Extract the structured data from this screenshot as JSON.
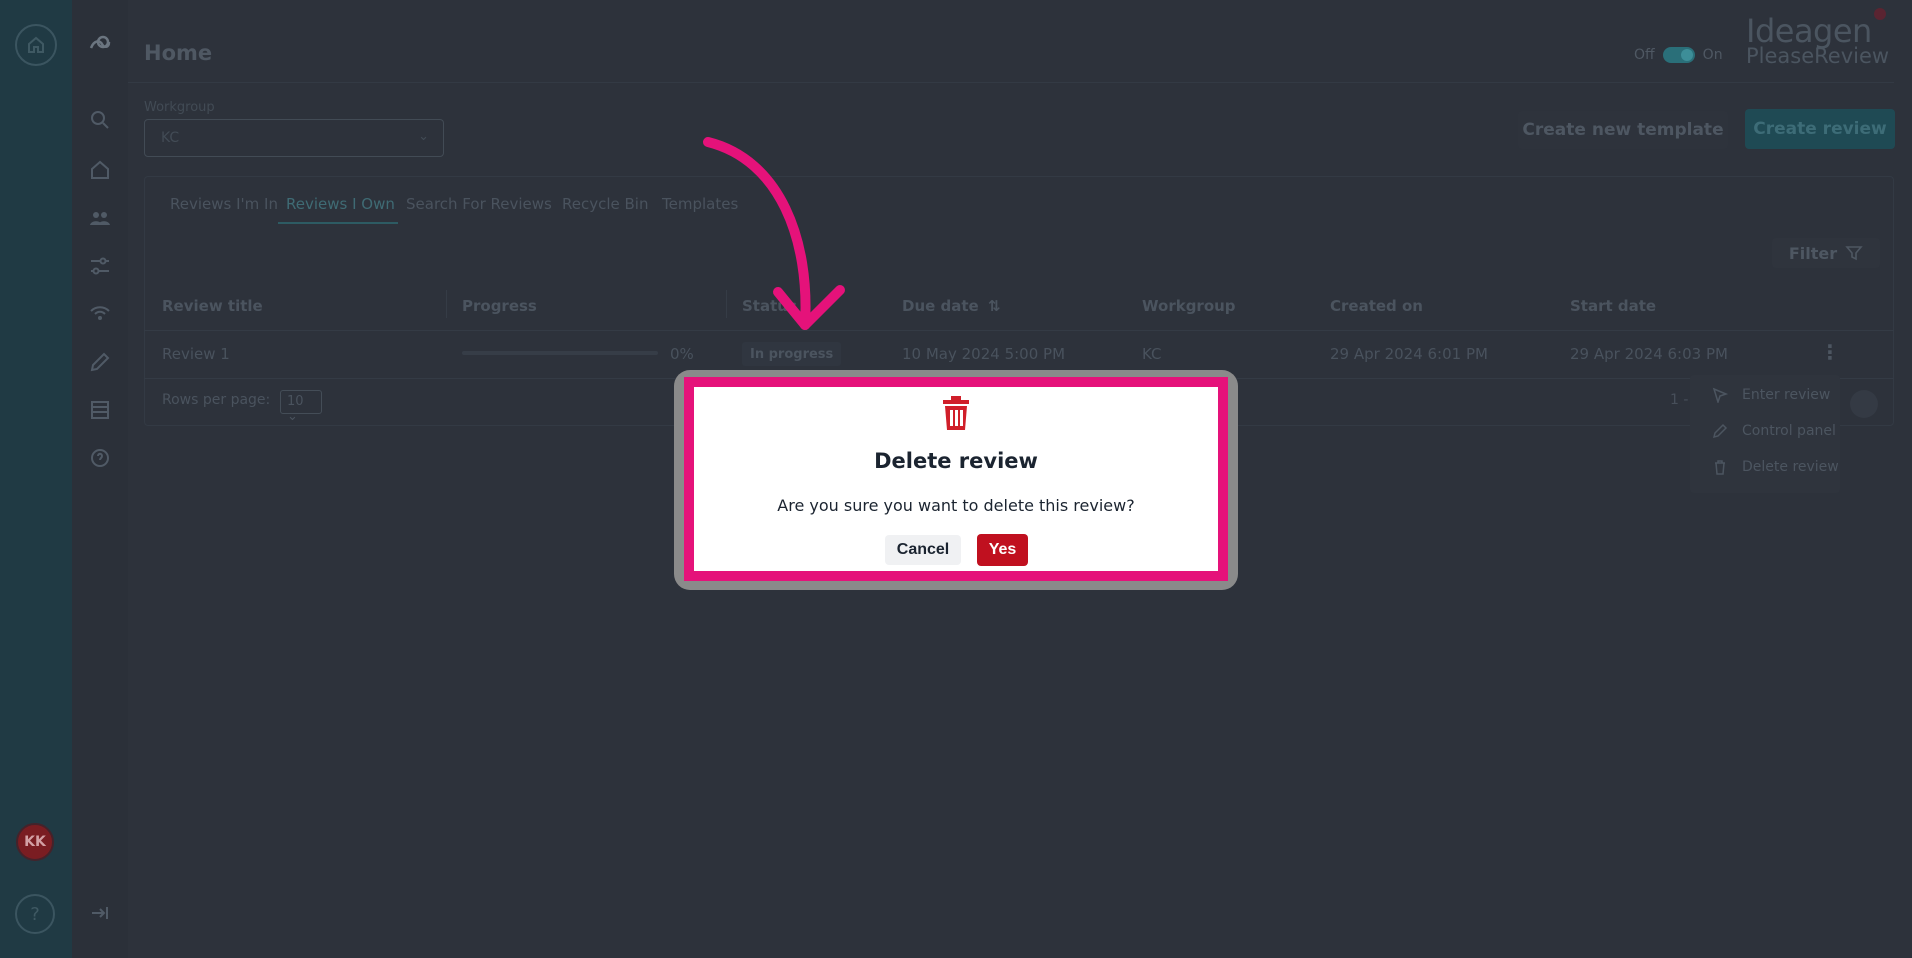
{
  "colors": {
    "accent": "#e5127a",
    "danger": "#c0101f",
    "brand_teal": "#1f4a54"
  },
  "header": {
    "title": "Home",
    "toggle_off": "Off",
    "toggle_on": "On",
    "brand_name": "Ideagen",
    "brand_product": "PleaseReview"
  },
  "workgroup": {
    "label": "Workgroup",
    "value": "KC"
  },
  "actions": {
    "create_template": "Create new template",
    "create_review": "Create review"
  },
  "tabs": [
    {
      "label": "Reviews I'm In"
    },
    {
      "label": "Reviews I Own"
    },
    {
      "label": "Search For Reviews"
    },
    {
      "label": "Recycle Bin"
    },
    {
      "label": "Templates"
    }
  ],
  "active_tab": "Reviews I Own",
  "filter_label": "Filter",
  "table": {
    "columns": [
      "Review title",
      "Progress",
      "Status",
      "Due date",
      "Workgroup",
      "Created on",
      "Start date"
    ],
    "rows": [
      {
        "title": "Review 1",
        "progress": "0%",
        "status": "In progress",
        "due": "10 May 2024 5:00 PM",
        "workgroup": "KC",
        "created": "29 Apr 2024 6:01 PM",
        "start": "29 Apr 2024 6:03 PM"
      }
    ],
    "rows_per_page_label": "Rows per page:",
    "rows_per_page": "10",
    "pager_text": "1 -"
  },
  "context_menu": [
    {
      "label": "Enter review",
      "icon": "cursor-icon"
    },
    {
      "label": "Control panel",
      "icon": "pencil-icon"
    },
    {
      "label": "Delete review",
      "icon": "trash-icon"
    }
  ],
  "user": {
    "initials": "KK"
  },
  "modal": {
    "title": "Delete review",
    "message": "Are you sure you want to delete this review?",
    "cancel": "Cancel",
    "confirm": "Yes",
    "icon": "trash-icon"
  }
}
